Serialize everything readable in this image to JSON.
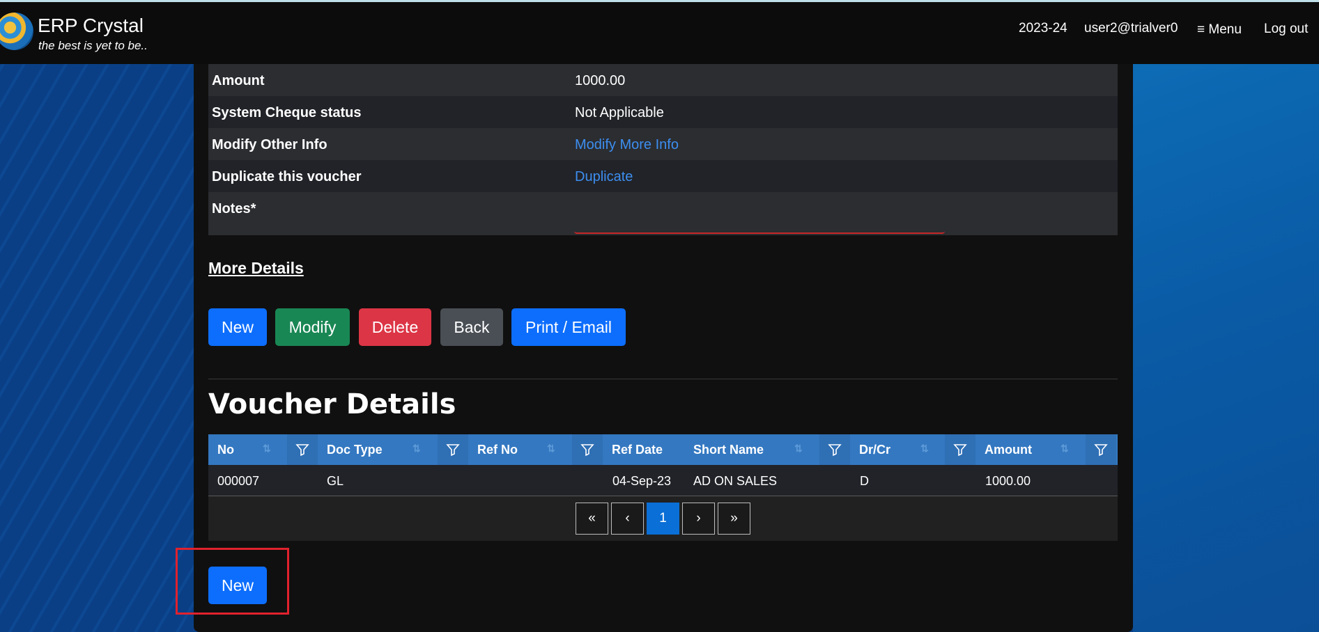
{
  "header": {
    "brand_title": "ERP Crystal",
    "brand_subtitle": "the best is yet to be..",
    "year": "2023-24",
    "user": "user2@trialver0",
    "menu_label": "≡ Menu",
    "logout_label": "Log out"
  },
  "details": {
    "rows": [
      {
        "label": "Amount",
        "value": "1000.00"
      },
      {
        "label": "System Cheque status",
        "value": "Not Applicable"
      },
      {
        "label": "Modify Other Info",
        "value": "Modify More Info"
      },
      {
        "label": "Duplicate this voucher",
        "value": "Duplicate"
      },
      {
        "label": "Notes*",
        "value": ""
      }
    ]
  },
  "more_details_label": "More Details",
  "actions": {
    "new": "New",
    "modify": "Modify",
    "delete": "Delete",
    "back": "Back",
    "print_email": "Print / Email"
  },
  "colors": {
    "primary": "#0d6efd",
    "success": "#198754",
    "danger": "#dc3545",
    "secondary": "#4a4f55",
    "grid_header": "#3478c1",
    "highlight": "#e0222d"
  },
  "voucher_details": {
    "title": "Voucher Details",
    "columns": [
      "No",
      "Doc Type",
      "Ref No",
      "Ref Date",
      "Short Name",
      "Dr/Cr",
      "Amount"
    ],
    "rows": [
      {
        "no": "000007",
        "doc_type": "GL",
        "ref_no": "",
        "ref_date": "04-Sep-23",
        "short_name": "AD ON SALES",
        "drcr": "D",
        "amount": "1000.00"
      }
    ]
  },
  "pagination": {
    "first": "«",
    "prev": "‹",
    "current": "1",
    "next": "›",
    "last": "»"
  },
  "bottom_new_label": "New"
}
